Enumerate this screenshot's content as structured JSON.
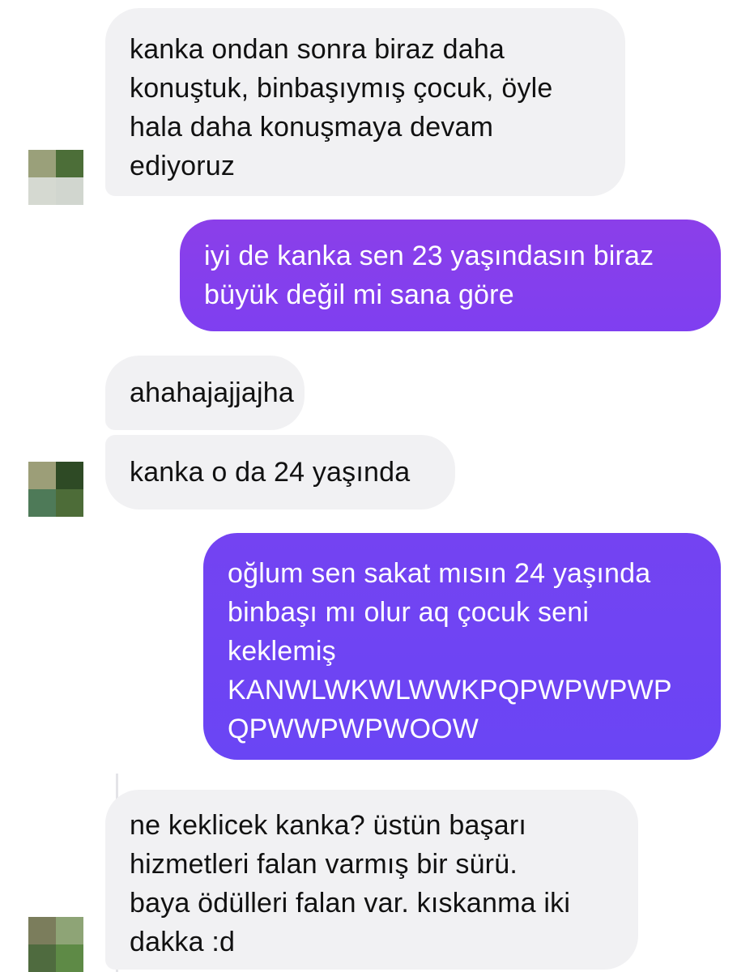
{
  "colors": {
    "incoming_bubble": "#f1f1f3",
    "outgoing_gradient_top": "#8b3fe9",
    "outgoing_gradient_bottom": "#6a45f4",
    "incoming_text": "#111111",
    "outgoing_text": "#ffffff"
  },
  "messages": [
    {
      "from": "contact",
      "lines": [
        "kanka ondan sonra biraz daha",
        "konuştuk, binbaşıymış çocuk, öyle",
        "hala daha konuşmaya devam",
        "ediyoruz"
      ]
    },
    {
      "from": "me",
      "lines": [
        "iyi de kanka sen 23 yaşındasın biraz",
        "büyük değil mi sana göre"
      ]
    },
    {
      "from": "contact",
      "lines": [
        "ahahajajjajha"
      ]
    },
    {
      "from": "contact",
      "lines": [
        "kanka o da 24 yaşında"
      ]
    },
    {
      "from": "me",
      "lines": [
        "oğlum sen sakat mısın 24 yaşında",
        "binbaşı mı olur aq çocuk seni",
        "keklemiş",
        "KANWLWKWLWWKPQPWPWPWP",
        "QPWWPWPWOOW"
      ]
    },
    {
      "from": "contact",
      "lines": [
        "ne keklicek kanka? üstün başarı",
        "hizmetleri falan varmış bir sürü.",
        "baya ödülleri falan var. kıskanma iki",
        "dakka :d"
      ]
    }
  ],
  "avatars": [
    {
      "icon": "blurred-profile-avatar",
      "tiles": [
        "#9aa07a",
        "#4c6e38",
        "#d5d9d1",
        "#d1d6cf"
      ]
    },
    {
      "icon": "blurred-profile-avatar",
      "tiles": [
        "#9c9e78",
        "#2e4a25",
        "#4e7a58",
        "#4d6c38"
      ]
    },
    {
      "icon": "blurred-profile-avatar",
      "tiles": [
        "#7b7d5c",
        "#8ea476",
        "#4f6b3f",
        "#5e8a46"
      ]
    }
  ]
}
